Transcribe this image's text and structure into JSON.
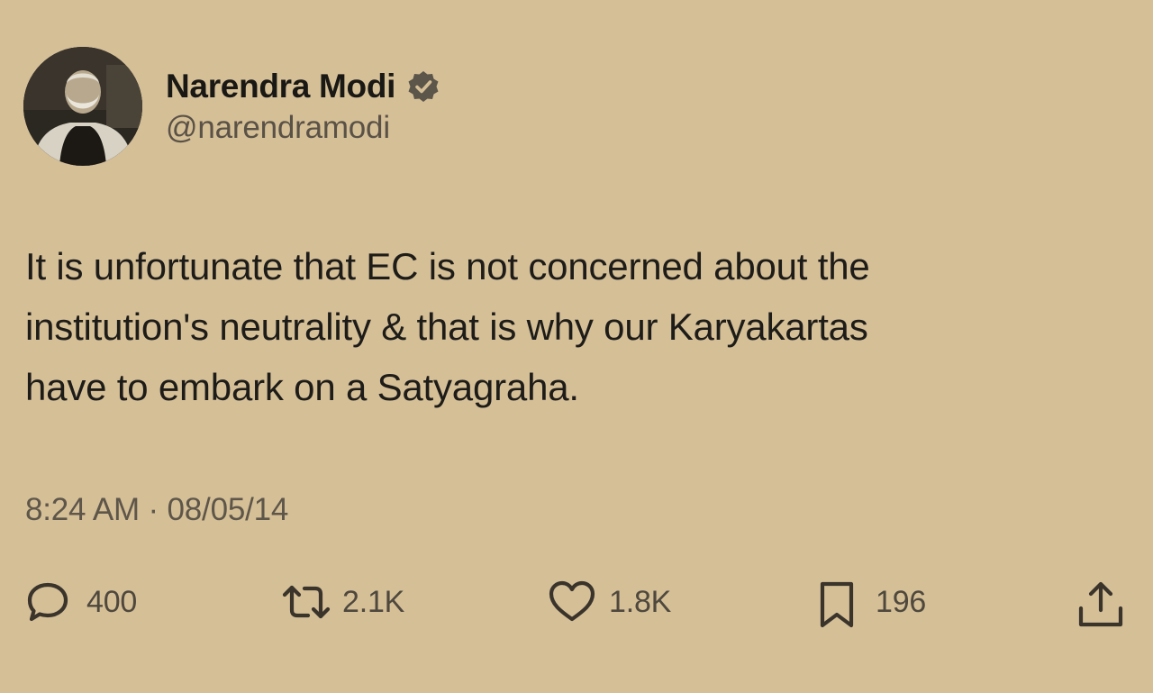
{
  "author": {
    "display_name": "Narendra Modi",
    "handle": "@narendramodi",
    "verified": true,
    "avatar_icon": "profile-photo"
  },
  "tweet": {
    "text": "It is unfortunate that EC is not concerned about the\ninstitution's neutrality & that is why our Karyakartas\nhave to embark on a Satyagraha.",
    "timestamp": "8:24 AM · 08/05/14"
  },
  "actions": {
    "replies": "400",
    "retweets": "2.1K",
    "likes": "1.8K",
    "bookmarks": "196"
  },
  "icons": {
    "reply": "reply-icon",
    "retweet": "retweet-icon",
    "like": "heart-icon",
    "bookmark": "bookmark-icon",
    "share": "share-icon",
    "verified": "verified-badge-icon"
  },
  "colors": {
    "background": "#d5bf97",
    "text": "#1e1c18",
    "secondary_text": "#5e5649"
  }
}
